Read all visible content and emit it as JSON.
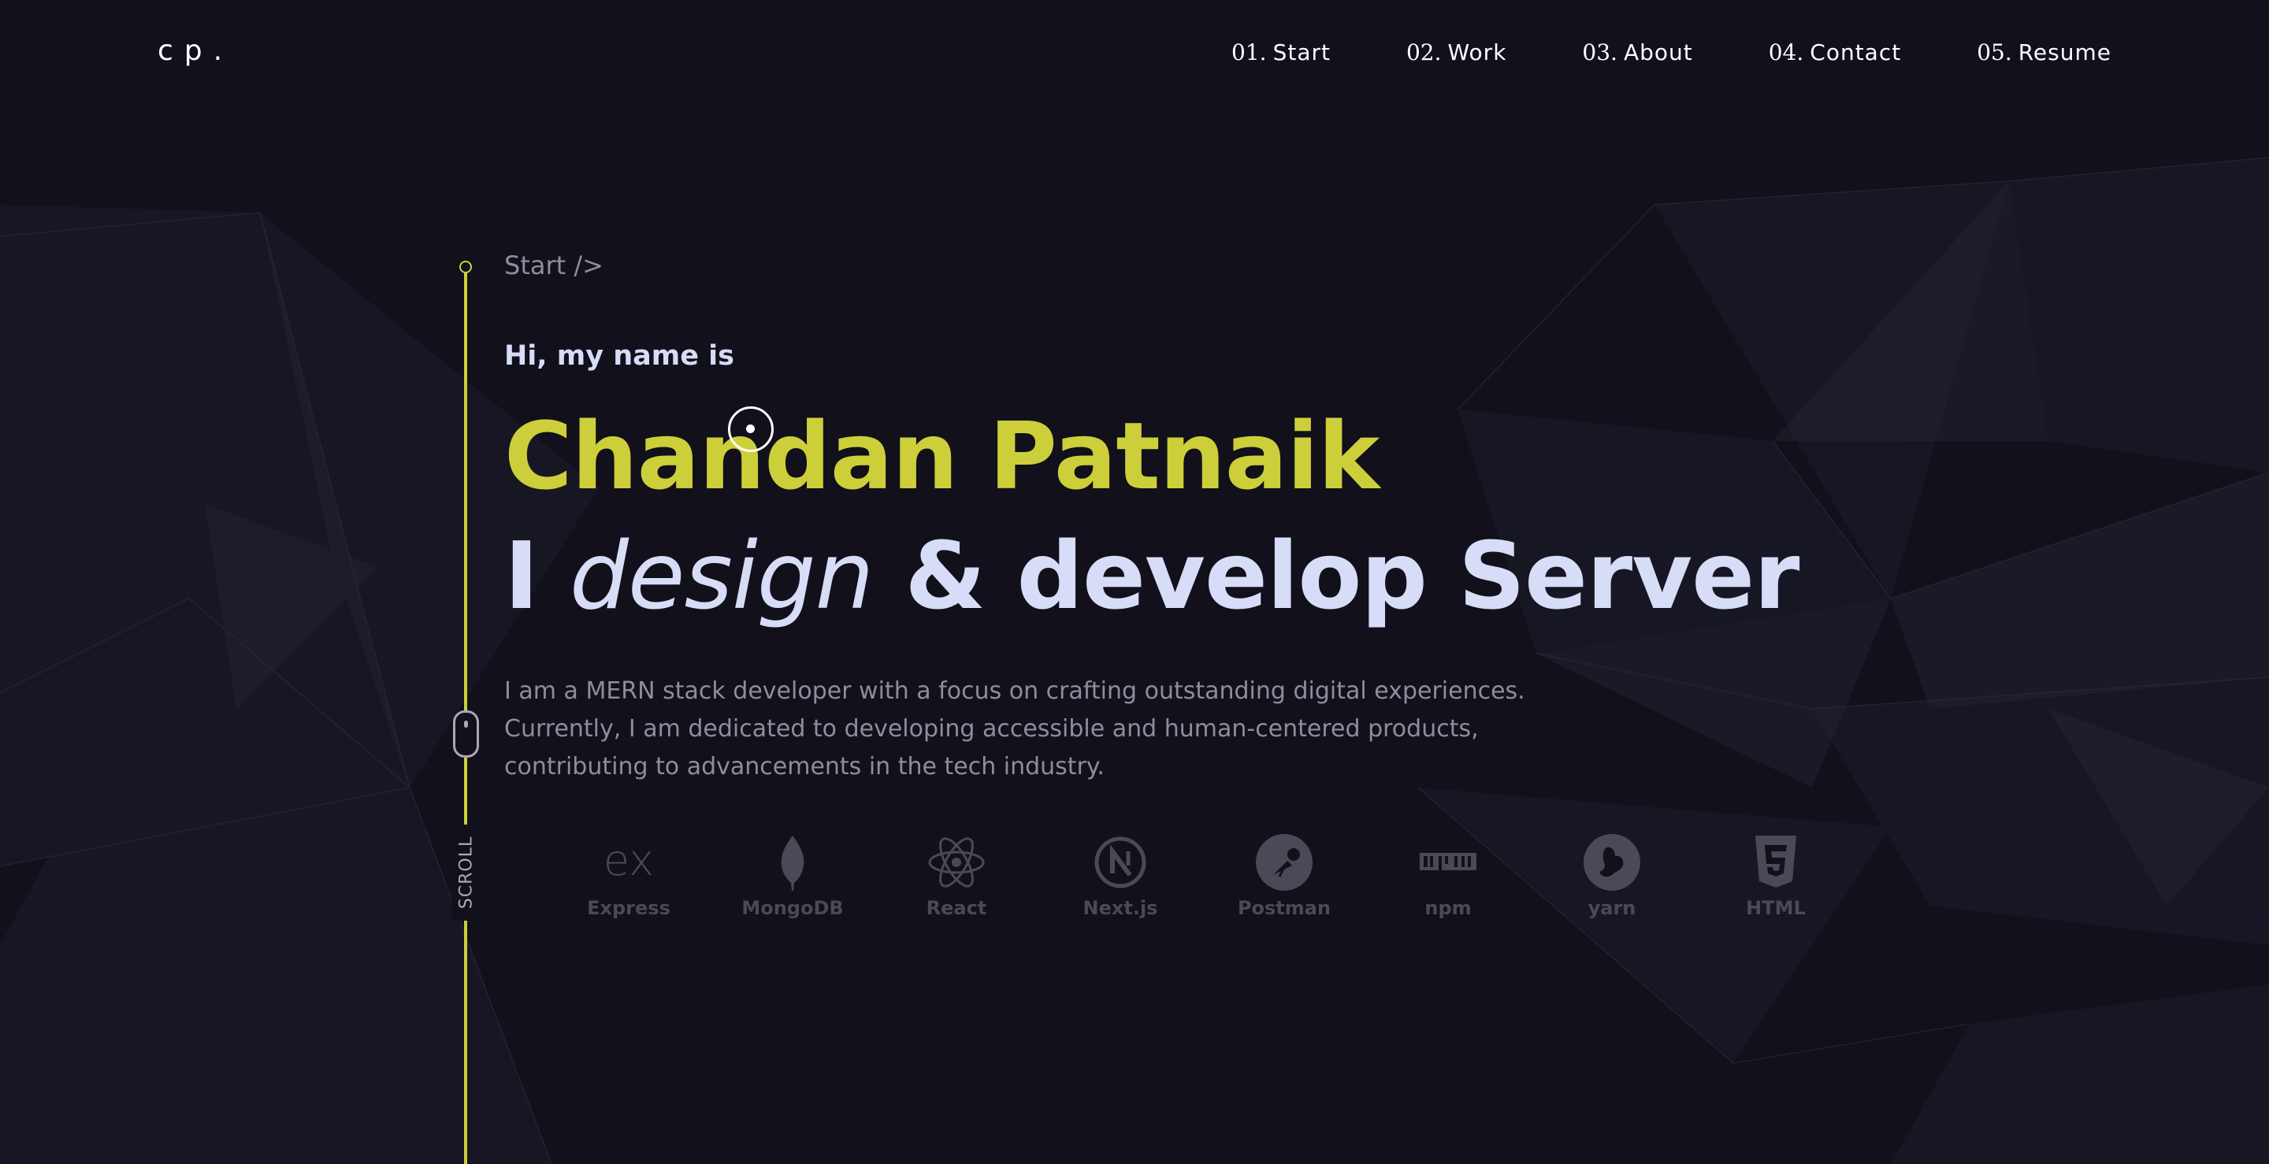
{
  "nav": {
    "logo": "cp.",
    "links": [
      {
        "num": "01.",
        "label": "Start"
      },
      {
        "num": "02.",
        "label": "Work"
      },
      {
        "num": "03.",
        "label": "About"
      },
      {
        "num": "04.",
        "label": "Contact"
      },
      {
        "num": "05.",
        "label": "Resume"
      }
    ]
  },
  "hero": {
    "section_tag": "Start />",
    "greeting": "Hi, my name is",
    "name": "Chandan Patnaik",
    "tagline": {
      "prefix": "I",
      "emphasis": "design",
      "suffix": "& develop Server"
    },
    "description": [
      "I am a MERN stack developer with a focus on crafting outstanding digital experiences.",
      "Currently, I am dedicated to developing accessible and human-centered products,",
      "contributing to advancements in the tech industry."
    ]
  },
  "scroll": {
    "label": "SCROLL"
  },
  "tech_stack": [
    {
      "label": "Express",
      "icon": "express-icon"
    },
    {
      "label": "MongoDB",
      "icon": "mongodb-icon"
    },
    {
      "label": "React",
      "icon": "react-icon"
    },
    {
      "label": "Next.js",
      "icon": "nextjs-icon"
    },
    {
      "label": "Postman",
      "icon": "postman-icon"
    },
    {
      "label": "npm",
      "icon": "npm-icon"
    },
    {
      "label": "yarn",
      "icon": "yarn-icon"
    },
    {
      "label": "HTML",
      "icon": "html5-icon"
    }
  ],
  "colors": {
    "background": "#11101b",
    "accent": "#cdcf3a",
    "heading": "#d7dcf7",
    "body_text": "#8d8e9c",
    "tech_icon": "#4a4a56"
  }
}
